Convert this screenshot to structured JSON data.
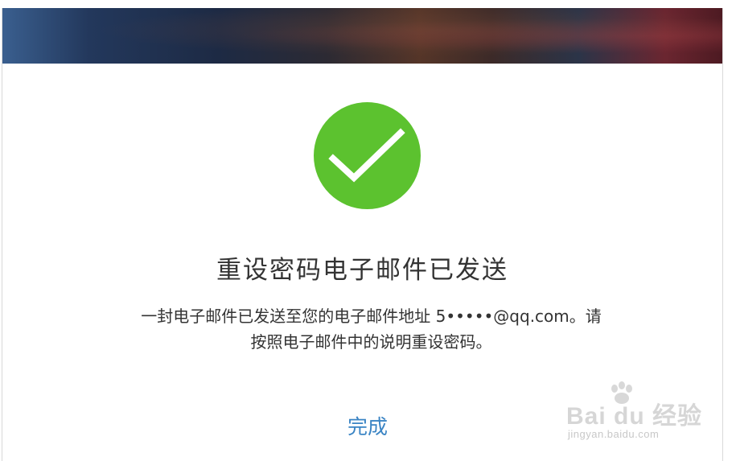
{
  "dialog": {
    "title": "重设密码电子邮件已发送",
    "message_line1": "一封电子邮件已发送至您的电子邮件地址 5•••••@qq.com。请",
    "message_line2": "按照电子邮件中的说明重设密码。",
    "done_label": "完成",
    "success_icon": "checkmark-icon"
  },
  "watermark": {
    "brand": "Bai du 经验",
    "url": "jingyan.baidu.com"
  },
  "colors": {
    "success_green": "#5cc22f",
    "link_blue": "#3a84c4",
    "text": "#333333"
  }
}
